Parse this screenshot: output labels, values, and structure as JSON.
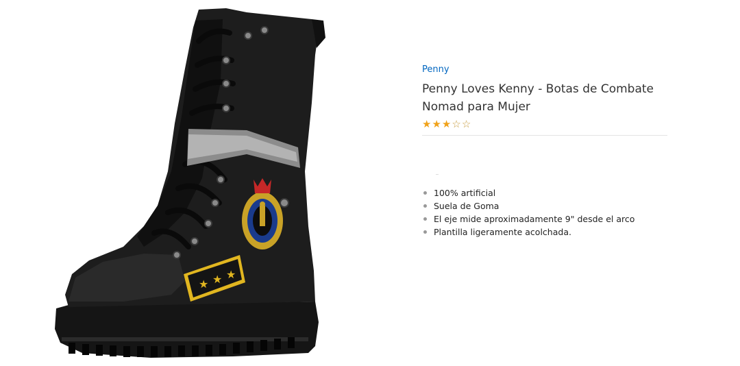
{
  "product": {
    "brand": "Penny",
    "title": "Penny Loves Kenny - Botas de Combate Nomad para Mujer",
    "rating": {
      "stars_filled": 3,
      "stars_total": 5
    },
    "image_icon": "boot-product-image",
    "features": [
      "100% artificial",
      "Suela de Goma",
      "El eje mide aproximadamente 9\" desde el arco",
      "Plantilla ligeramente acolchada."
    ]
  },
  "colors": {
    "link": "#0066c0",
    "star": "#f0a21a",
    "title": "#333333"
  }
}
